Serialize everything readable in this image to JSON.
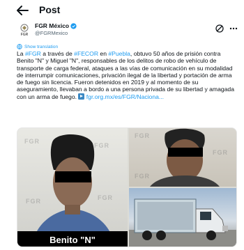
{
  "header": {
    "title": "Post"
  },
  "author": {
    "name": "FGR México",
    "handle": "@FGRMexico",
    "avatar_caption": "FGR"
  },
  "translate_label": "Show translation",
  "post": {
    "t1": "La ",
    "h1": "#FGR",
    "t2": " a través de ",
    "h2": "#FECOR",
    "t3": " en ",
    "h3": "#Puebla",
    "t4": ", obtuvo 50 años de prisión contra Benito \"N\" y Miguel \"N\", responsables de los delitos de robo de vehículo de transporte de carga federal, ataques a las vías de comunicación en su modalidad de interrumpir comunicaciones, privación ilegal de la libertad y portación de arma de fuego sin licencia. Fueron detenidos en 2019 y al momento de su aseguramiento, llevaban a bordo a una persona privada de su libertad y amagada con un arma de fuego. ",
    "link": "fgr.org.mx/es/FGR/Naciona..."
  },
  "media": {
    "caption_left": "Benito \"N\""
  },
  "colors": {
    "link": "#1d9bf0",
    "verified": "#1d9bf0",
    "text": "#0f1419",
    "muted": "#536471"
  }
}
